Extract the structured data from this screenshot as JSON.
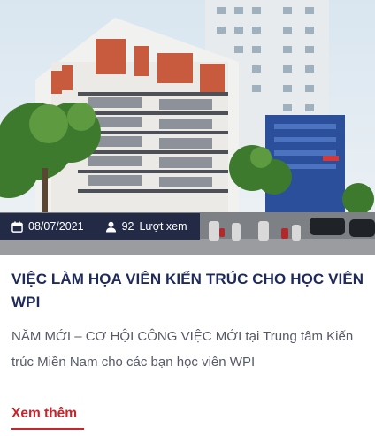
{
  "post": {
    "date": "08/07/2021",
    "view_count": "92",
    "view_label": "Lượt xem",
    "title": "VIỆC LÀM HỌA VIÊN KIẾN TRÚC CHO HỌC VIÊN WPI",
    "excerpt": "NĂM MỚI – CƠ HỘI CÔNG VIỆC MỚI tại Trung tâm Kiến trúc Miền Nam cho các bạn học viên WPI",
    "read_more": "Xem thêm"
  },
  "icons": {
    "date": "calendar-icon",
    "views": "user-icon"
  },
  "colors": {
    "title": "#1f2a5c",
    "accent": "#c8242c",
    "meta_bar": "#161e3c"
  }
}
